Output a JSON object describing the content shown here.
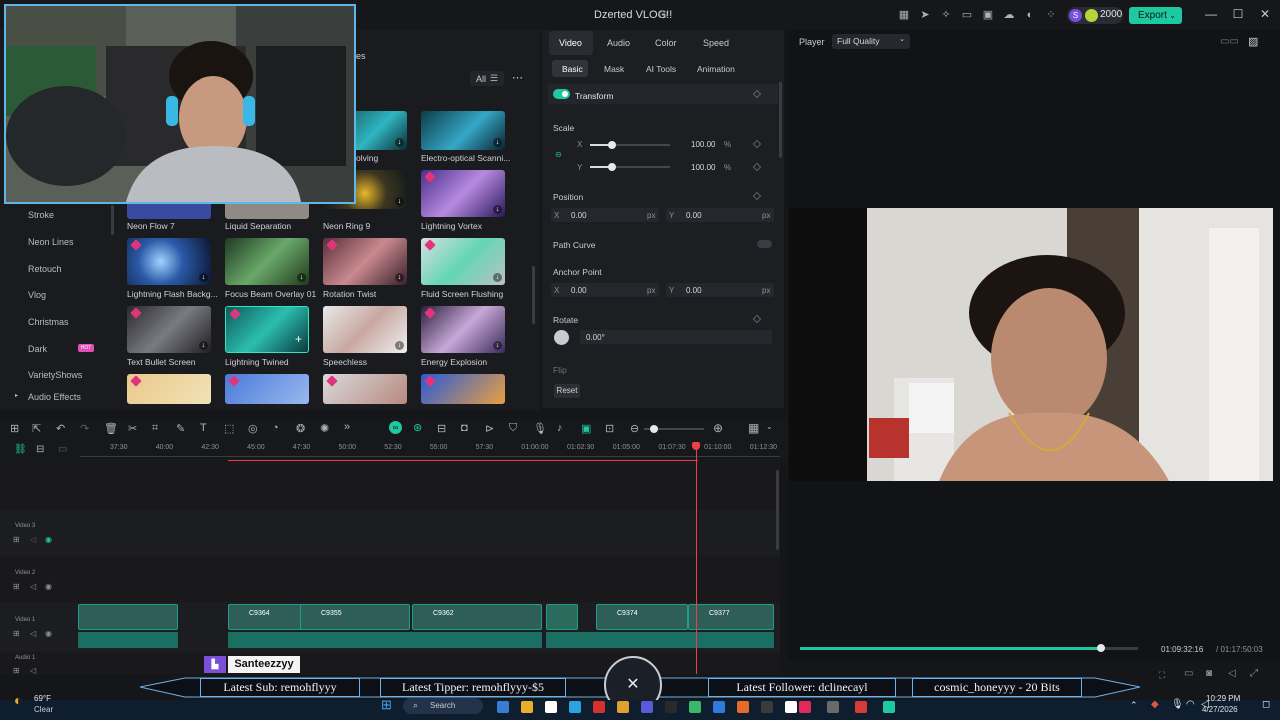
{
  "window": {
    "title": "Dzerted VLOG!!",
    "credits": "2000",
    "export_label": "Export"
  },
  "left_panel": {
    "filter_label": "All",
    "categories": [
      "Stroke",
      "Neon Lines",
      "Retouch",
      "Vlog",
      "Christmas",
      "Dark",
      "VarietyShows",
      "Audio Effects"
    ],
    "hot_badge": "HOT",
    "partial_labels": [
      "es",
      "olving"
    ],
    "assets": [
      {
        "label": "Electro-optical Scanni..."
      },
      {
        "label": "Neon Flow 7"
      },
      {
        "label": "Liquid Separation"
      },
      {
        "label": "Neon Ring 9"
      },
      {
        "label": "Lightning Vortex"
      },
      {
        "label": "Lightning Flash Backg..."
      },
      {
        "label": "Focus Beam Overlay 01"
      },
      {
        "label": "Rotation Twist"
      },
      {
        "label": "Fluid Screen Flushing"
      },
      {
        "label": "Text Bullet Screen"
      },
      {
        "label": "Lightning Twined"
      },
      {
        "label": "Speechless"
      },
      {
        "label": "Energy Explosion"
      }
    ]
  },
  "properties": {
    "tabs": [
      "Video",
      "Audio",
      "Color",
      "Speed"
    ],
    "subtabs": [
      "Basic",
      "Mask",
      "AI Tools",
      "Animation"
    ],
    "transform_label": "Transform",
    "scale_label": "Scale",
    "scale_x_label": "X",
    "scale_y_label": "Y",
    "scale_x": "100.00",
    "scale_y": "100.00",
    "percent": "%",
    "scale_x_fraction": 0.28,
    "scale_y_fraction": 0.28,
    "position_label": "Position",
    "pos_x_label": "X",
    "pos_y_label": "Y",
    "pos_x": "0.00",
    "pos_y": "0.00",
    "px": "px",
    "path_curve_label": "Path Curve",
    "anchor_label": "Anchor Point",
    "anchor_x_label": "X",
    "anchor_y_label": "Y",
    "anchor_x": "0.00",
    "anchor_y": "0.00",
    "rotate_label": "Rotate",
    "rotate_value": "0.00°",
    "flip_label": "Flip",
    "reset_label": "Reset"
  },
  "player": {
    "label": "Player",
    "quality": "Full Quality",
    "current_time": "01:09:32:16",
    "total_time": "/  01:17:50:03",
    "progress": 0.89
  },
  "timeline": {
    "ticks": [
      "37:30",
      "40:00",
      "42:30",
      "45:00",
      "47:30",
      "50:00",
      "52:30",
      "55:00",
      "57:30",
      "01:00:00",
      "01:02:30",
      "01:05:00",
      "01:07:30",
      "01:10:00",
      "01:12:30"
    ],
    "tracks": [
      "Video 3",
      "Video 2",
      "Video 1",
      "Audio 1"
    ],
    "clip_labels": [
      "C9364",
      "C9355",
      "C9362",
      "C9374",
      "C9377"
    ]
  },
  "stream_overlay": {
    "name": "Santeezzyy",
    "latest_sub": "Latest Sub: remohflyyy",
    "latest_tipper": "Latest Tipper: remohflyyy-$5",
    "latest_follower": "Latest Follower: dclinecayl",
    "bits": "cosmic_honeyyy - 20 Bits"
  },
  "taskbar": {
    "temperature": "69°F",
    "weather": "Clear",
    "search": "Search",
    "time": "10:29 PM",
    "date": "4/27/2026"
  },
  "colors": {
    "accent": "#1ec8a0",
    "playhead": "#e8414a",
    "webcam_border": "#5fb7e8"
  }
}
